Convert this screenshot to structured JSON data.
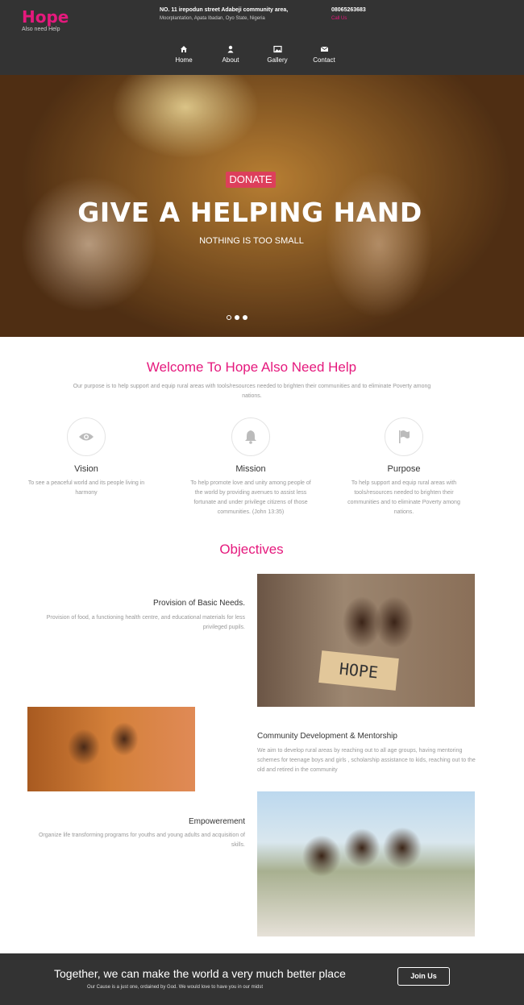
{
  "brand": {
    "title": "Hope",
    "subtitle": "Also need Help",
    "accent_color": "#e5197d"
  },
  "address": {
    "line1": "NO. 11 irepodun street Adabeji community area,",
    "line2": "Moorplantation, Apata Ibadan, Oyo State, Nigeria"
  },
  "contact": {
    "phone": "08065263683",
    "call_label": "Call Us"
  },
  "nav": {
    "items": [
      {
        "label": "Home",
        "icon": "home-icon"
      },
      {
        "label": "About",
        "icon": "user-icon"
      },
      {
        "label": "Gallery",
        "icon": "image-icon"
      },
      {
        "label": "Contact",
        "icon": "envelope-icon"
      }
    ]
  },
  "hero": {
    "button_label": "DONATE",
    "title": "GIVE A HELPING HAND",
    "subtitle": "NOTHING IS TOO SMALL",
    "donate_color": "#dd3f5b"
  },
  "welcome": {
    "title": "Welcome To Hope Also Need Help",
    "text": "Our purpose is to help support and equip rural areas with tools/resources needed to brighten their communities and to eliminate Poverty among nations."
  },
  "features": [
    {
      "icon": "eye-icon",
      "title": "Vision",
      "text": "To see a peaceful world and its people living in harmony"
    },
    {
      "icon": "bell-icon",
      "title": "Mission",
      "text": "To help promote love and unity among people of the world by providing avenues to assist less fortunate and under privilege citizens of those communities. (John 13:35)"
    },
    {
      "icon": "flag-icon",
      "title": "Purpose",
      "text": "To help support and equip rural areas with tools/resources needed to brighten their communities and to eliminate Poverty among nations."
    }
  ],
  "objectives": {
    "title": "Objectives",
    "items": [
      {
        "title": "Provision of Basic Needs.",
        "text": "Provision of food, a functioning health centre, and educational materials for less privileged pupils."
      },
      {
        "title": "Community Development & Mentorship",
        "text": "We aim to develop rural areas by reaching out to all age groups, having mentoring schemes for teenage boys and girls , scholarship assistance to kids, reaching out to the old and retired in the community"
      },
      {
        "title": "Empowerement",
        "text": "Organize life transforming programs for youths and young adults and acquisition of skills."
      }
    ],
    "photo_sign": "HOPE"
  },
  "footer": {
    "title": "Together, we can make the world a very much better place",
    "text": "Our Cause is a just one, ordained by God. We would love to have you in our midst",
    "button_label": "Join Us"
  }
}
